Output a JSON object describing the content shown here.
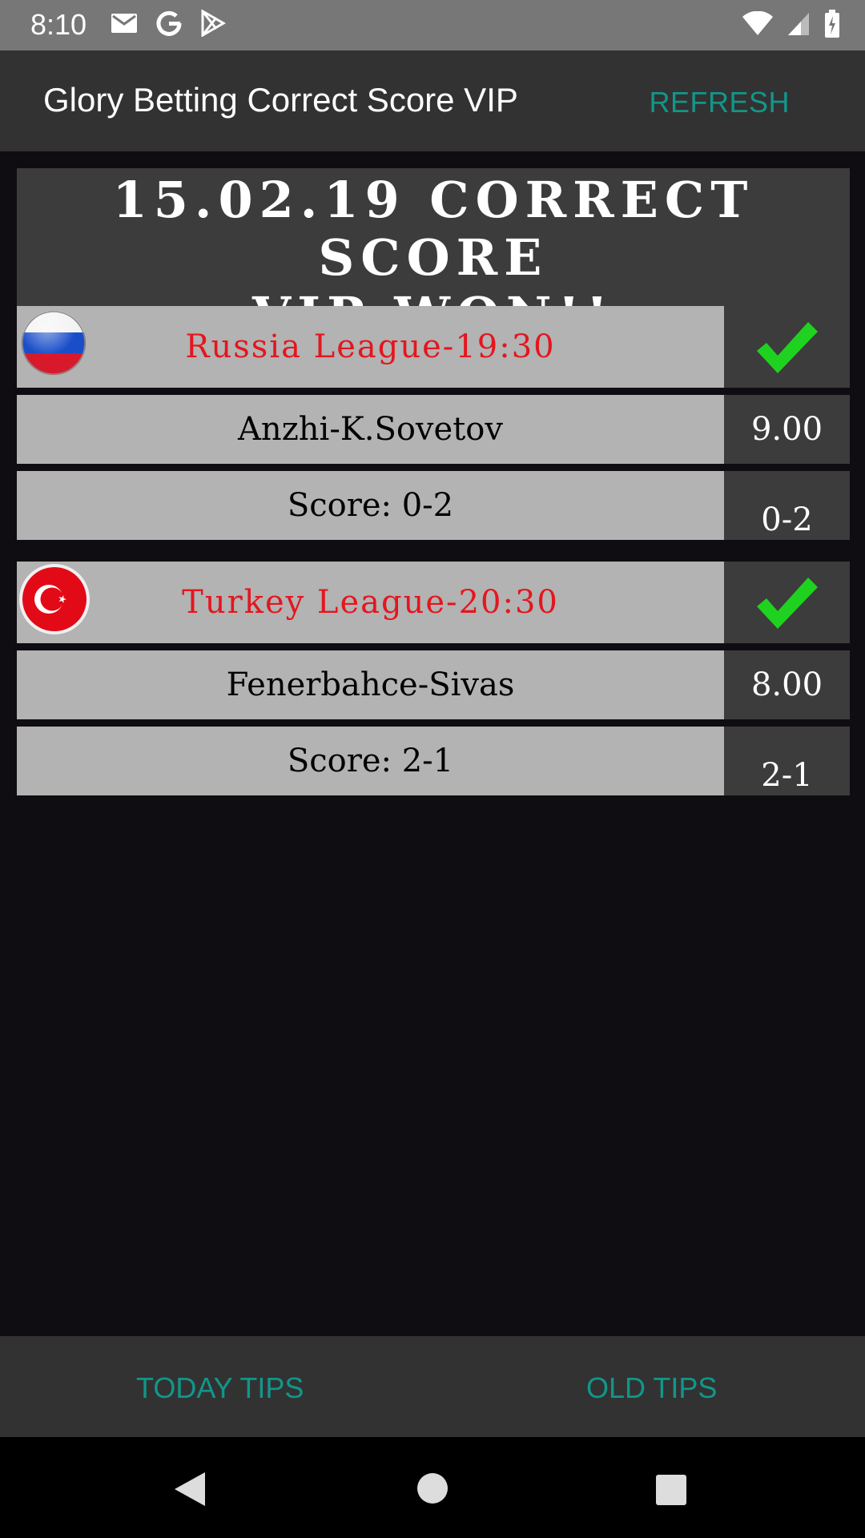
{
  "status_bar": {
    "time": "8:10",
    "left_icons": [
      "gmail-icon",
      "google-icon",
      "play-store-icon"
    ],
    "right_icons": [
      "wifi-icon",
      "signal-icon",
      "battery-icon"
    ]
  },
  "app_bar": {
    "title": "Glory Betting Correct Score VIP",
    "refresh_label": "REFRESH"
  },
  "banner": {
    "line1": "15.02.19 CORRECT SCORE",
    "line2": "VIP WON!!"
  },
  "matches": [
    {
      "flag": "russia-flag-icon",
      "league": "Russia League-19:30",
      "status_icon": "checkmark-icon",
      "teams": "Anzhi-K.Sovetov",
      "odds": "9.00",
      "score_label": "Score: 0-2",
      "result": "0-2"
    },
    {
      "flag": "turkey-flag-icon",
      "league": "Turkey League-20:30",
      "status_icon": "checkmark-icon",
      "teams": "Fenerbahce-Sivas",
      "odds": "8.00",
      "score_label": "Score: 2-1",
      "result": "2-1"
    }
  ],
  "bottom_tabs": {
    "today": "TODAY TIPS",
    "old": "OLD TIPS"
  },
  "nav_bar": [
    "back-icon",
    "home-icon",
    "recents-icon"
  ],
  "colors": {
    "accent": "#12968a",
    "league_text": "#e5151e",
    "check": "#1fd21f"
  }
}
